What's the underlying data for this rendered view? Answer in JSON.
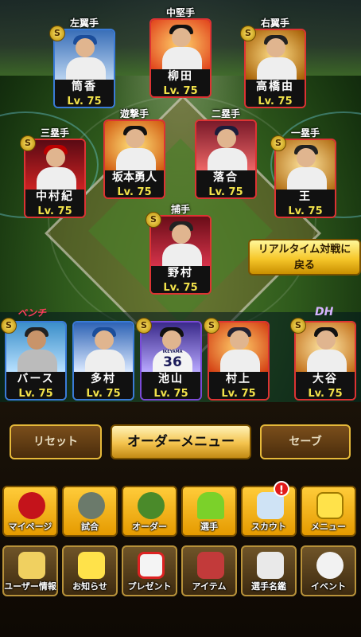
{
  "positions": {
    "lf": {
      "pos": "左翼手",
      "name": "筒香",
      "lv": "Lv. 75"
    },
    "cf": {
      "pos": "中堅手",
      "name": "柳田",
      "lv": "Lv. 75"
    },
    "rf": {
      "pos": "右翼手",
      "name": "高橋由",
      "lv": "Lv. 75"
    },
    "ss": {
      "pos": "遊撃手",
      "name": "坂本勇人",
      "lv": "Lv. 75"
    },
    "b2": {
      "pos": "二塁手",
      "name": "落合",
      "lv": "Lv. 75"
    },
    "b3": {
      "pos": "三塁手",
      "name": "中村紀",
      "lv": "Lv. 75"
    },
    "b1": {
      "pos": "一塁手",
      "name": "王",
      "lv": "Lv. 75"
    },
    "c": {
      "pos": "捕手",
      "name": "野村",
      "lv": "Lv. 75"
    }
  },
  "bench_label": "ベンチ",
  "dh_label": "DH",
  "bench": [
    {
      "name": "バース",
      "lv": "Lv. 75"
    },
    {
      "name": "多村",
      "lv": "Lv. 75"
    },
    {
      "name": "池山",
      "lv": "Lv. 75"
    },
    {
      "name": "村上",
      "lv": "Lv. 75"
    }
  ],
  "dh": {
    "name": "大谷",
    "lv": "Lv. 75"
  },
  "jersey_number": "36",
  "jersey_text": "IKEYAMA",
  "realtime_button": {
    "line1": "リアルタイム対戦に",
    "line2": "戻る"
  },
  "buttons": {
    "reset": "リセット",
    "order_menu": "オーダーメニュー",
    "save": "セーブ"
  },
  "menu_row1": [
    {
      "label": "マイページ",
      "icon": "mypage-a-icon"
    },
    {
      "label": "試合",
      "icon": "stadium-icon"
    },
    {
      "label": "オーダー",
      "icon": "order-field-icon"
    },
    {
      "label": "選手",
      "icon": "player-silhouette-icon"
    },
    {
      "label": "スカウト",
      "icon": "scout-ticket-icon"
    },
    {
      "label": "メニュー",
      "icon": "menu-character-icon"
    }
  ],
  "notification_badge": "!",
  "menu_row2": [
    {
      "label": "ユーザー情報",
      "icon": "user-info-icon"
    },
    {
      "label": "お知らせ",
      "icon": "notice-character-icon"
    },
    {
      "label": "プレゼント",
      "icon": "present-box-icon"
    },
    {
      "label": "アイテム",
      "icon": "item-card-icon"
    },
    {
      "label": "選手名鑑",
      "icon": "player-directory-icon"
    },
    {
      "label": "イベント",
      "icon": "baseball-bats-icon"
    }
  ],
  "colors": {
    "lv_text": "#f2e24a",
    "gold_button": "#f3c24c",
    "bench_label": "#ff3b5c",
    "dh_label": "#d6b3ff"
  }
}
